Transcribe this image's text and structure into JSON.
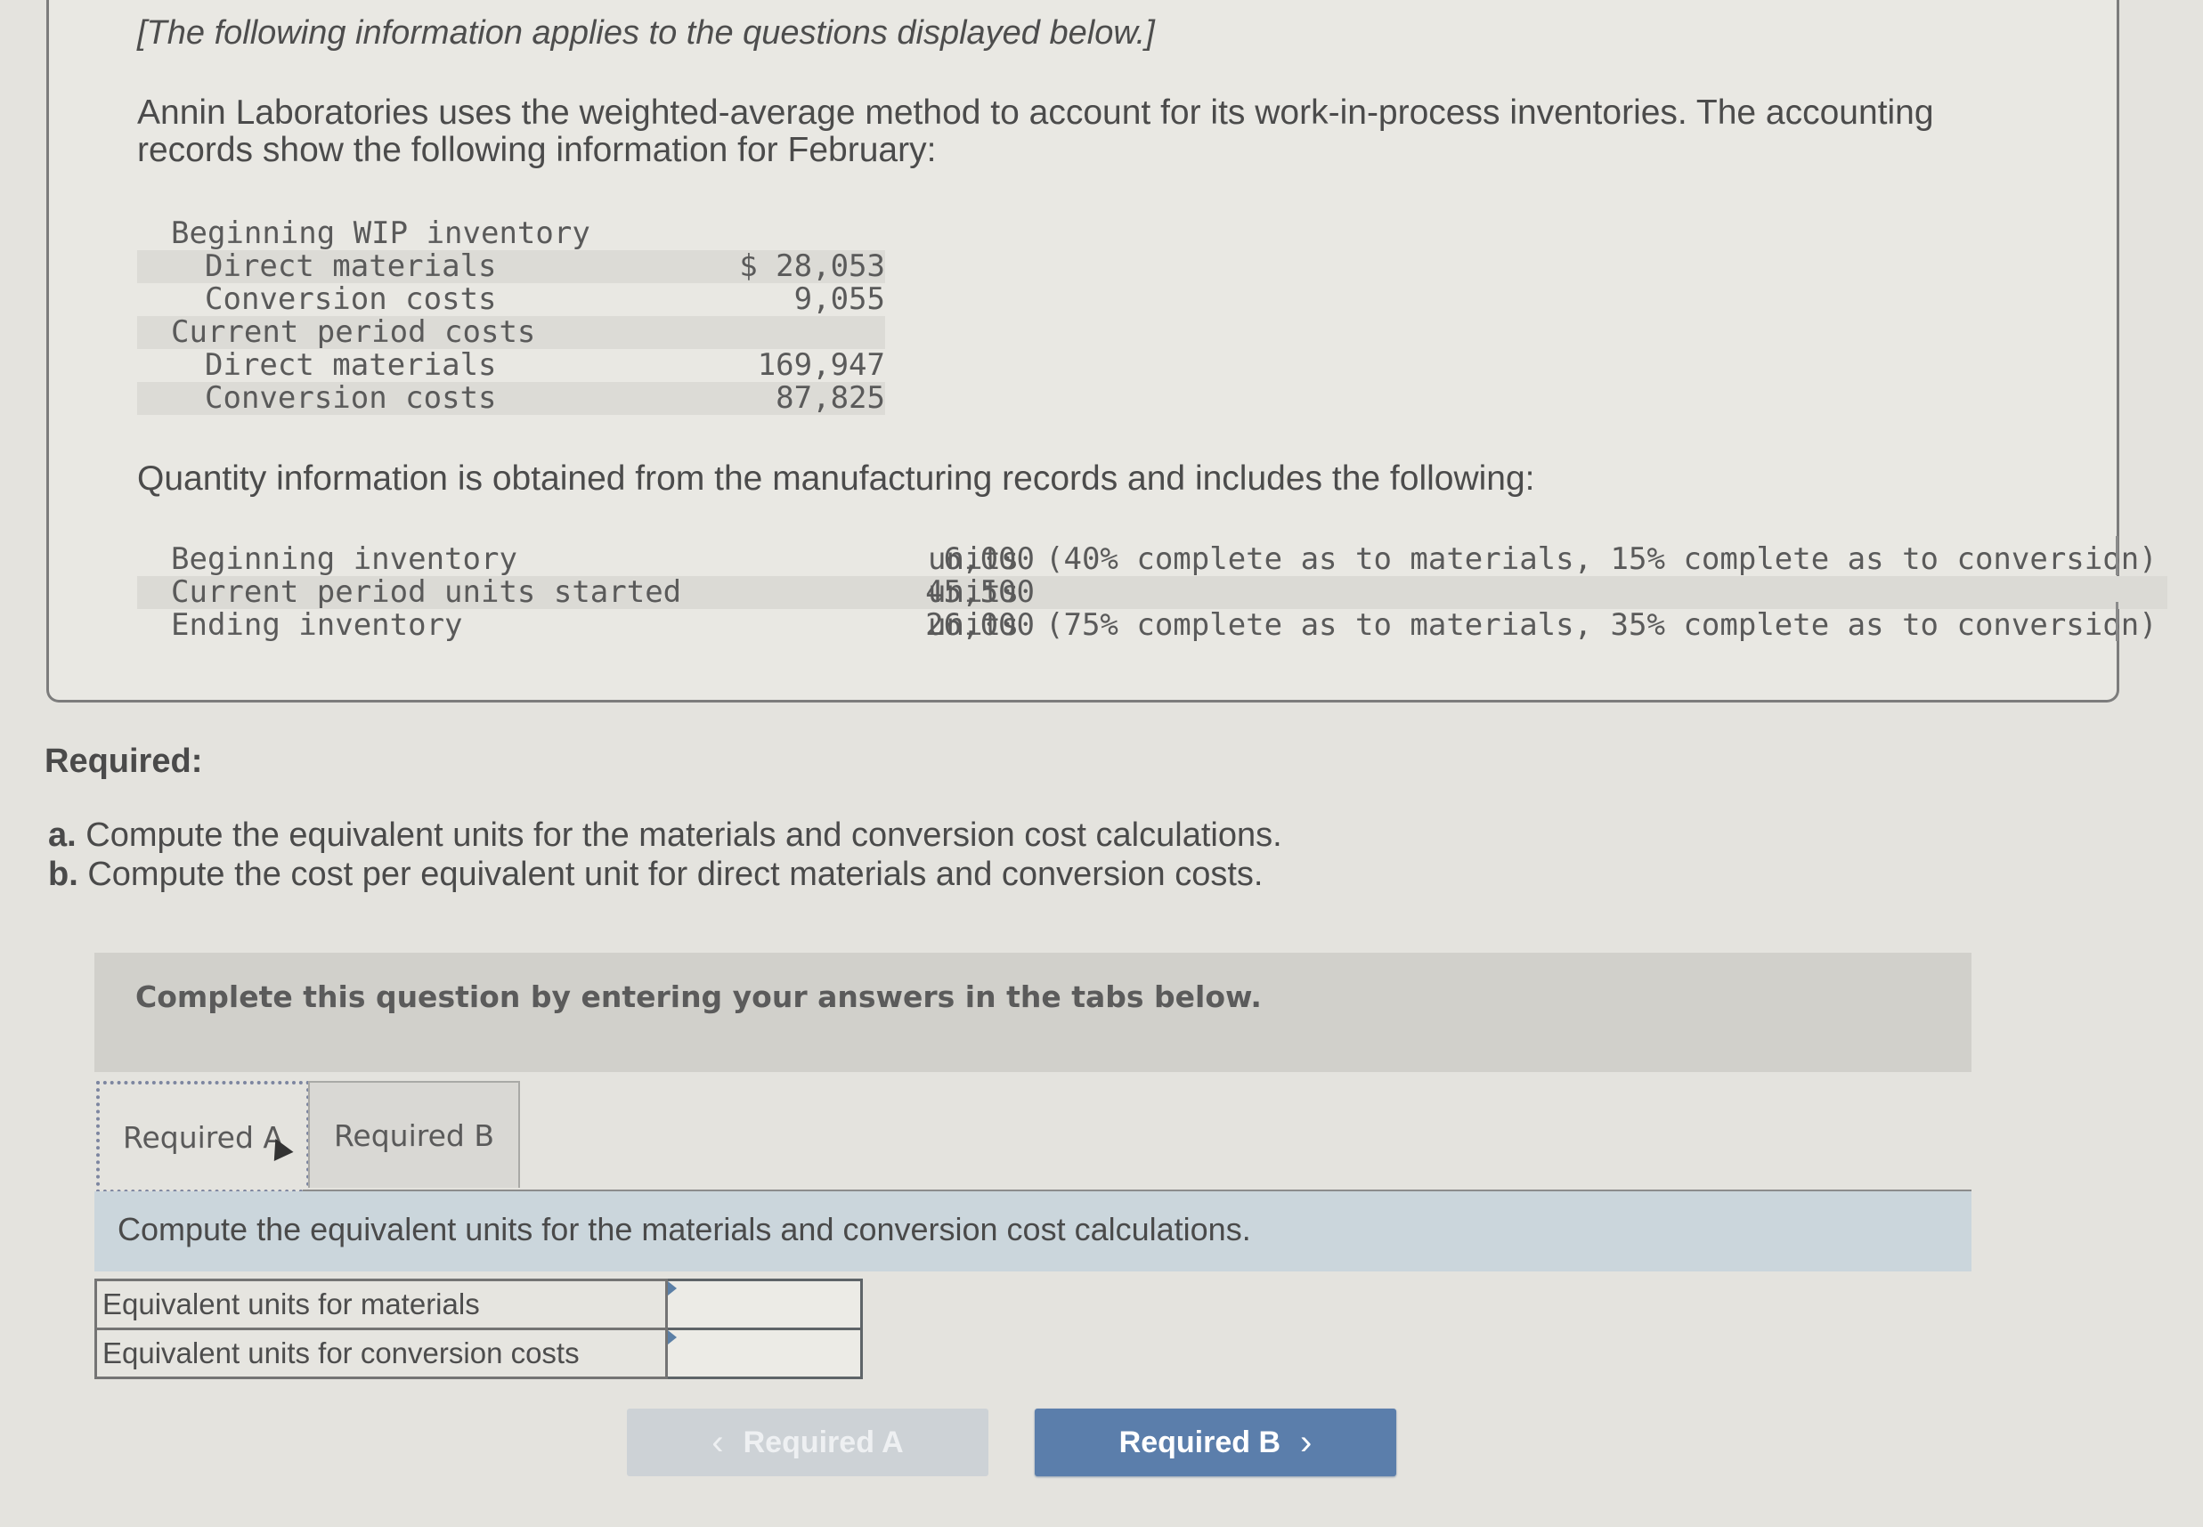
{
  "intro": "[The following information applies to the questions displayed below.]",
  "description": "Annin Laboratories uses the weighted-average method to account for its work-in-process inventories. The accounting records show the following information for February:",
  "cost_table": {
    "rows": [
      {
        "label": "Beginning WIP inventory",
        "indent": false,
        "value": ""
      },
      {
        "label": "Direct materials",
        "indent": true,
        "value": "$ 28,053"
      },
      {
        "label": "Conversion costs",
        "indent": true,
        "value": "9,055"
      },
      {
        "label": "Current period costs",
        "indent": false,
        "value": ""
      },
      {
        "label": "Direct materials",
        "indent": true,
        "value": "169,947"
      },
      {
        "label": "Conversion costs",
        "indent": true,
        "value": "87,825"
      }
    ]
  },
  "quantity_intro": "Quantity information is obtained from the manufacturing records and includes the following:",
  "quantity_table": {
    "rows": [
      {
        "label": "Beginning inventory",
        "units": "6,000",
        "unit_label": "units",
        "note": "(40% complete as to materials, 15% complete as to conversion)"
      },
      {
        "label": "Current period units started",
        "units": "45,500",
        "unit_label": "units",
        "note": ""
      },
      {
        "label": "Ending inventory",
        "units": "26,000",
        "unit_label": "units",
        "note": "(75% complete as to materials, 35% complete as to conversion)"
      }
    ]
  },
  "required": {
    "heading": "Required:",
    "items": [
      {
        "letter": "a.",
        "text": "Compute the equivalent units for the materials and conversion cost calculations."
      },
      {
        "letter": "b.",
        "text": "Compute the cost per equivalent unit for direct materials and conversion costs."
      }
    ]
  },
  "banner": "Complete this question by entering your answers in the tabs below.",
  "tabs": [
    {
      "label": "Required A",
      "active": true
    },
    {
      "label": "Required B",
      "active": false
    }
  ],
  "instruction": "Compute the equivalent units for the materials and conversion cost calculations.",
  "answer_table": {
    "rows": [
      {
        "label": "Equivalent units for materials",
        "value": ""
      },
      {
        "label": "Equivalent units for conversion costs",
        "value": ""
      }
    ]
  },
  "navigation": {
    "prev_label": "Required A",
    "next_label": "Required B",
    "prev_icon": "chevron-left-icon",
    "next_icon": "chevron-right-icon",
    "colors": {
      "next_bg": "#5b7eab",
      "prev_bg": "#cdd2d6"
    }
  }
}
